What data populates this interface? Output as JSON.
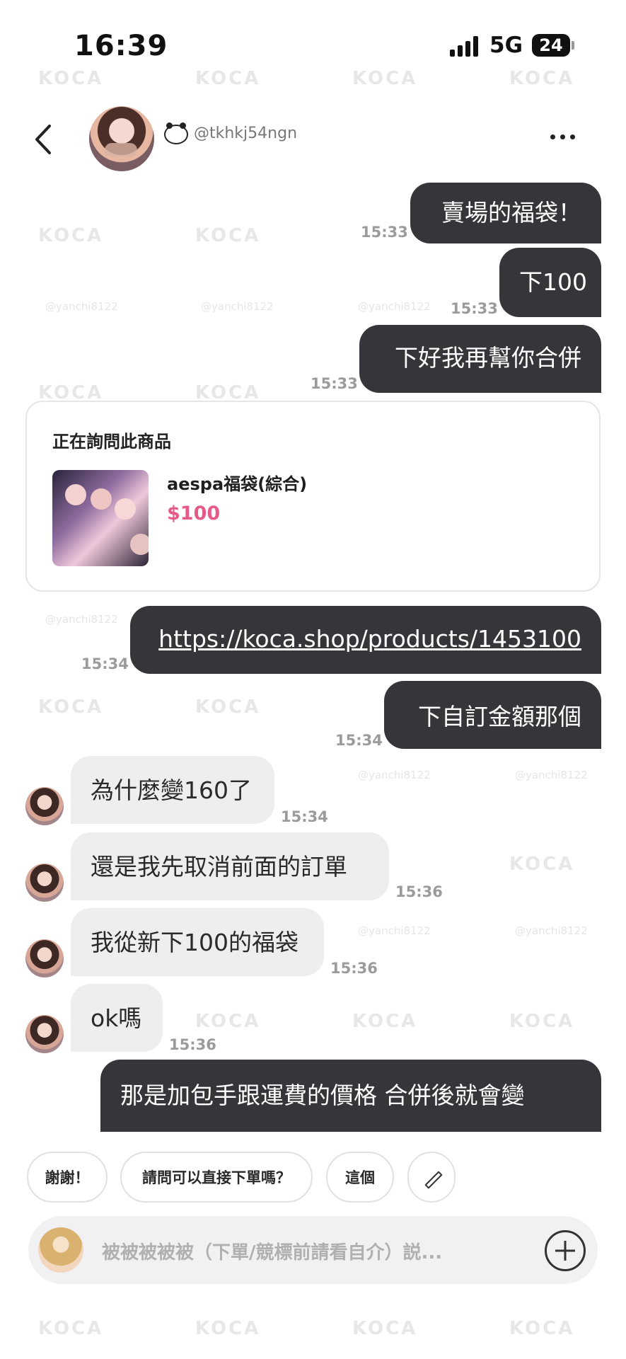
{
  "status_bar": {
    "time": "16:39",
    "network": "5G",
    "battery": "24"
  },
  "header": {
    "username": "@tkhkj54ngn"
  },
  "messages": [
    {
      "text": "賣場的福袋！",
      "time": "15:33"
    },
    {
      "text": "下100",
      "time": "15:33"
    },
    {
      "text": "下好我再幫你合併",
      "time": "15:33"
    },
    {
      "text": "https://koca.shop/products/1453100",
      "time": "15:34"
    },
    {
      "text": "下自訂金額那個",
      "time": "15:34"
    },
    {
      "text": "為什麼變160了",
      "time": "15:34"
    },
    {
      "text": "還是我先取消前面的訂單",
      "time": "15:36"
    },
    {
      "text": "我從新下100的福袋",
      "time": "15:36"
    },
    {
      "text": "ok嗎",
      "time": "15:36"
    },
    {
      "text": "那是加包手跟運費的價格 合併後就會變",
      "time": ""
    }
  ],
  "product": {
    "heading": "正在詢問此商品",
    "name": "aespa福袋(綜合)",
    "price": "$100"
  },
  "quick_replies": [
    "謝謝！",
    "請問可以直接下單嗎？",
    "這個"
  ],
  "input": {
    "placeholder": "被被被被被（下單/競標前請看自介）説..."
  },
  "watermark": {
    "brand": "KOCA",
    "handle": "@yanchi8122"
  },
  "icons": [
    "back-chevron-icon",
    "panda-icon",
    "more-dots-icon",
    "edit-pencil-icon",
    "plus-icon"
  ],
  "colors": {
    "my_bubble": "#34363a",
    "their_bubble": "#eeeef0",
    "price": "#e65a8a"
  }
}
